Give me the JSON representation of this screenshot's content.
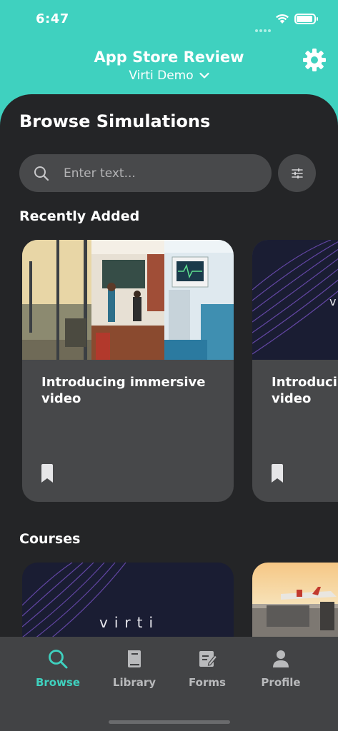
{
  "status": {
    "time": "6:47"
  },
  "header": {
    "title": "App Store Review",
    "workspace": "Virti Demo"
  },
  "browse": {
    "title": "Browse Simulations",
    "search": {
      "placeholder": "Enter text..."
    },
    "recent": {
      "heading": "Recently Added",
      "cards": [
        {
          "title": "Introducing immersive video"
        },
        {
          "title": "Introducing immersive video"
        }
      ]
    },
    "courses": {
      "heading": "Courses",
      "logo_text": "virti"
    }
  },
  "tabs": [
    {
      "label": "Browse",
      "icon": "search-icon",
      "active": true
    },
    {
      "label": "Library",
      "icon": "book-icon",
      "active": false
    },
    {
      "label": "Forms",
      "icon": "form-edit-icon",
      "active": false
    },
    {
      "label": "Profile",
      "icon": "person-icon",
      "active": false
    }
  ],
  "colors": {
    "accent": "#3fd1bf",
    "panel": "#242527",
    "card": "#47484a",
    "tabbar": "#424345",
    "navy": "#1a1d33"
  }
}
